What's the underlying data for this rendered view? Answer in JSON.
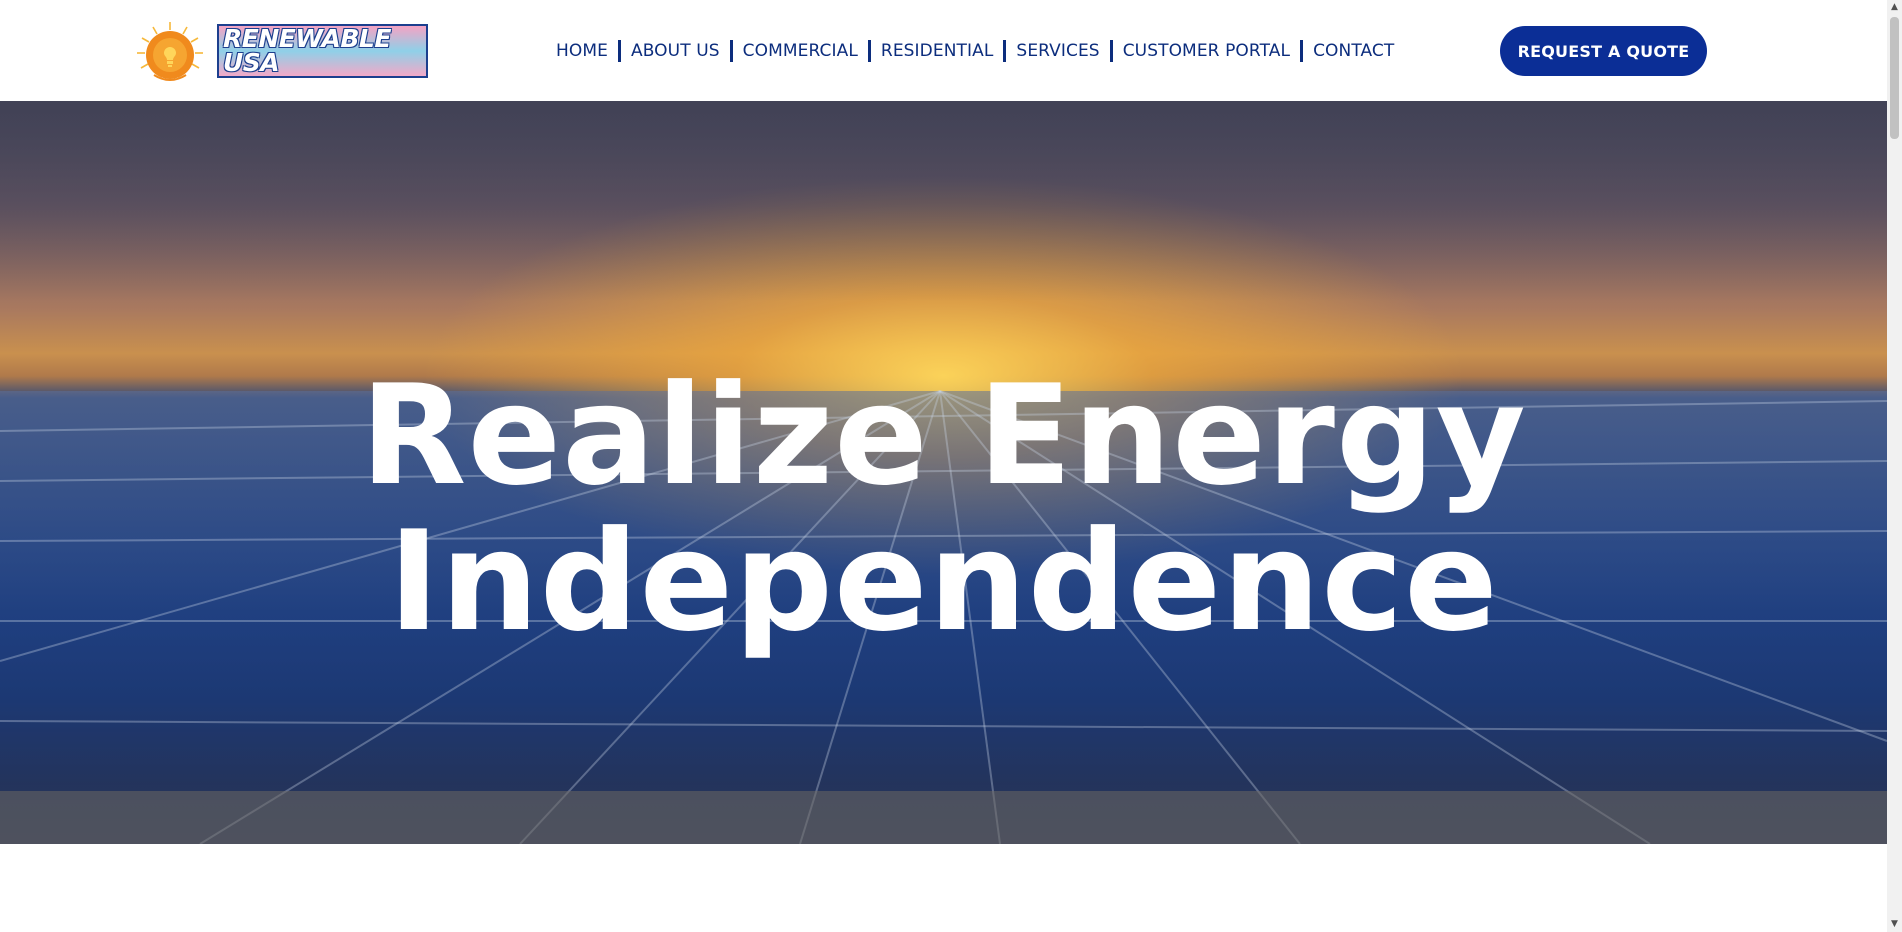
{
  "brand": {
    "name": "RENEWABLE USA"
  },
  "nav": {
    "items": [
      {
        "label": "HOME"
      },
      {
        "label": "ABOUT US"
      },
      {
        "label": "COMMERCIAL"
      },
      {
        "label": "RESIDENTIAL"
      },
      {
        "label": "SERVICES"
      },
      {
        "label": "CUSTOMER PORTAL"
      },
      {
        "label": "CONTACT"
      }
    ]
  },
  "cta": {
    "label": "REQUEST A QUOTE"
  },
  "hero": {
    "title_line1": "Realize Energy",
    "title_line2": "Independence"
  },
  "colors": {
    "brand_navy": "#0b2e96",
    "nav_text": "#0c2d7d",
    "logo_sun": "#f39a1e"
  },
  "icons": {
    "logo": "sun-lightbulb-icon",
    "scroll_up": "chevron-up-icon",
    "scroll_down": "chevron-down-icon"
  }
}
